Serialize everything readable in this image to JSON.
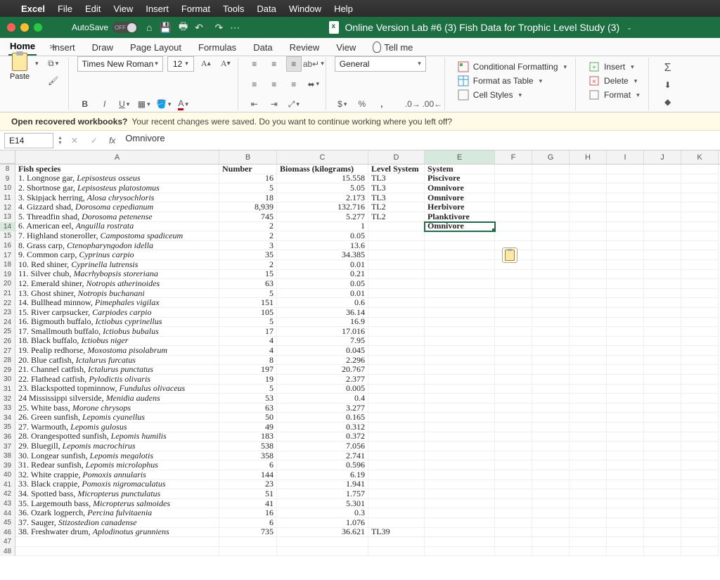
{
  "mac_menu": {
    "app": "Excel",
    "items": [
      "File",
      "Edit",
      "View",
      "Insert",
      "Format",
      "Tools",
      "Data",
      "Window",
      "Help"
    ]
  },
  "titlebar": {
    "autosave_label": "AutoSave",
    "autosave_state": "OFF",
    "doc_title": "Online Version Lab #6 (3) Fish Data for Trophic Level Study (3)"
  },
  "tabs": {
    "items": [
      "Home",
      "Insert",
      "Draw",
      "Page Layout",
      "Formulas",
      "Data",
      "Review",
      "View"
    ],
    "active": "Home",
    "tellme": "Tell me"
  },
  "ribbon": {
    "paste": "Paste",
    "font_name": "Times New Roman",
    "font_size": "12",
    "number_format": "General",
    "cond_fmt": "Conditional Formatting",
    "table": "Format as Table",
    "styles": "Cell Styles",
    "insert": "Insert",
    "delete": "Delete",
    "format": "Format"
  },
  "banner": {
    "bold": "Open recovered workbooks?",
    "rest": "Your recent changes were saved. Do you want to continue working where you left off?"
  },
  "formula_bar": {
    "namebox": "E14",
    "value": "Omnivore"
  },
  "columns": [
    "A",
    "B",
    "C",
    "D",
    "E",
    "F",
    "G",
    "H",
    "I",
    "J",
    "K"
  ],
  "selected_col": "E",
  "active_cell": {
    "row": 14,
    "col": "E"
  },
  "headers_row": 8,
  "headers": {
    "A": "Fish species",
    "B": "Number",
    "C": "Biomass (kilograms)",
    "D": "Level System",
    "E": "System"
  },
  "rows": [
    {
      "r": 9,
      "num": "1.",
      "name": "Longnose gar,",
      "sci": "Lepisosteus osseus",
      "B": "16",
      "C": "15.558",
      "D": "TL3",
      "E": "Piscivore"
    },
    {
      "r": 10,
      "num": "2.",
      "name": "Shortnose gar,",
      "sci": "Lepisosteus platostomus",
      "B": "5",
      "C": "5.05",
      "D": "TL3",
      "E": "Omnivore"
    },
    {
      "r": 11,
      "num": "3.",
      "name": "Skipjack herring,",
      "sci": "Alosa chrysochloris",
      "B": "18",
      "C": "2.173",
      "D": "TL3",
      "E": "Omnivore"
    },
    {
      "r": 12,
      "num": "4.",
      "name": "Gizzard shad,",
      "sci": "Dorosoma cepedianum",
      "B": "8,939",
      "C": "132.716",
      "D": "TL2",
      "E": "Herbivore"
    },
    {
      "r": 13,
      "num": "5.",
      "name": "Threadfin shad,",
      "sci": "Dorosoma petenense",
      "B": "745",
      "C": "5.277",
      "D": "TL2",
      "E": "Planktivore"
    },
    {
      "r": 14,
      "num": "6.",
      "name": "American eel,",
      "sci": "Anguilla rostrata",
      "B": "2",
      "C": "1",
      "D": "",
      "E": "Omnivore"
    },
    {
      "r": 15,
      "num": "7.",
      "name": "Highland stoneroller,",
      "sci": "Campostoma spadiceum",
      "B": "2",
      "C": "0.05",
      "D": "",
      "E": ""
    },
    {
      "r": 16,
      "num": "8.",
      "name": "Grass carp,",
      "sci": "Ctenopharyngodon idella",
      "B": "3",
      "C": "13.6",
      "D": "",
      "E": ""
    },
    {
      "r": 17,
      "num": "9.",
      "name": "Common carp,",
      "sci": "Cyprinus carpio",
      "B": "35",
      "C": "34.385",
      "D": "",
      "E": ""
    },
    {
      "r": 18,
      "num": "10.",
      "name": "Red shiner,",
      "sci": "Cyprinella lutrensis",
      "B": "2",
      "C": "0.01",
      "D": "",
      "E": ""
    },
    {
      "r": 19,
      "num": "11.",
      "name": "Silver chub,",
      "sci": "Macrhybopsis storeriana",
      "B": "15",
      "C": "0.21",
      "D": "",
      "E": ""
    },
    {
      "r": 20,
      "num": "12.",
      "name": "Emerald shiner,",
      "sci": "Notropis atherinoides",
      "B": "63",
      "C": "0.05",
      "D": "",
      "E": ""
    },
    {
      "r": 21,
      "num": "13.",
      "name": "Ghost shiner,",
      "sci": "Notropis buchanani",
      "B": "5",
      "C": "0.01",
      "D": "",
      "E": ""
    },
    {
      "r": 22,
      "num": "14.",
      "name": "Bullhead minnow,",
      "sci": "Pimephales vigilax",
      "B": "151",
      "C": "0.6",
      "D": "",
      "E": ""
    },
    {
      "r": 23,
      "num": "15.",
      "name": "River carpsucker,",
      "sci": "Carpiodes carpio",
      "B": "105",
      "C": "36.14",
      "D": "",
      "E": ""
    },
    {
      "r": 24,
      "num": "16.",
      "name": "Bigmouth buffalo,",
      "sci": "Ictiobus cyprinellus",
      "B": "5",
      "C": "16.9",
      "D": "",
      "E": ""
    },
    {
      "r": 25,
      "num": "17.",
      "name": "Smallmouth buffalo,",
      "sci": "Ictiobus bubalus",
      "B": "17",
      "C": "17.016",
      "D": "",
      "E": ""
    },
    {
      "r": 26,
      "num": "18.",
      "name": "Black buffalo,",
      "sci": "Ictiobus niger",
      "B": "4",
      "C": "7.95",
      "D": "",
      "E": ""
    },
    {
      "r": 27,
      "num": "19.",
      "name": "Pealip redhorse,",
      "sci": "Moxostoma pisolabrum",
      "B": "4",
      "C": "0.045",
      "D": "",
      "E": ""
    },
    {
      "r": 28,
      "num": "20.",
      "name": "Blue catfish,",
      "sci": "Ictalurus furcatus",
      "B": "8",
      "C": "2.296",
      "D": "",
      "E": ""
    },
    {
      "r": 29,
      "num": "21.",
      "name": "Channel catfish,",
      "sci": "Ictalurus punctatus",
      "B": "197",
      "C": "20.767",
      "D": "",
      "E": ""
    },
    {
      "r": 30,
      "num": "22.",
      "name": "Flathead catfish,",
      "sci": "Pylodictis olivaris",
      "B": "19",
      "C": "2.377",
      "D": "",
      "E": ""
    },
    {
      "r": 31,
      "num": "23.",
      "name": "Blackspotted topminnow,",
      "sci": "Fundulus olivaceus",
      "B": "5",
      "C": "0.005",
      "D": "",
      "E": ""
    },
    {
      "r": 32,
      "num": "24",
      "name": "Mississippi silverside,",
      "sci": "Menidia audens",
      "B": "53",
      "C": "0.4",
      "D": "",
      "E": ""
    },
    {
      "r": 33,
      "num": "25.",
      "name": "White bass,",
      "sci": "Morone chrysops",
      "B": "63",
      "C": "3.277",
      "D": "",
      "E": ""
    },
    {
      "r": 34,
      "num": "26.",
      "name": "Green sunfish,",
      "sci": "Lepomis cyanellus",
      "B": "50",
      "C": "0.165",
      "D": "",
      "E": ""
    },
    {
      "r": 35,
      "num": "27.",
      "name": "Warmouth,",
      "sci": "Lepomis gulosus",
      "B": "49",
      "C": "0.312",
      "D": "",
      "E": ""
    },
    {
      "r": 36,
      "num": "28.",
      "name": "Orangespotted sunfish,",
      "sci": "Lepomis humilis",
      "B": "183",
      "C": "0.372",
      "D": "",
      "E": ""
    },
    {
      "r": 37,
      "num": "29.",
      "name": "Bluegill,",
      "sci": "Lepomis macrochirus",
      "B": "538",
      "C": "7.056",
      "D": "",
      "E": ""
    },
    {
      "r": 38,
      "num": "30.",
      "name": "Longear sunfish,",
      "sci": "Lepomis megalotis",
      "B": "358",
      "C": "2.741",
      "D": "",
      "E": ""
    },
    {
      "r": 39,
      "num": "31.",
      "name": "Redear sunfish,",
      "sci": "Lepomis microlophus",
      "B": "6",
      "C": "0.596",
      "D": "",
      "E": ""
    },
    {
      "r": 40,
      "num": "32.",
      "name": "White crappie,",
      "sci": "Pomoxis annularis",
      "B": "144",
      "C": "6.19",
      "D": "",
      "E": ""
    },
    {
      "r": 41,
      "num": "33.",
      "name": "Black crappie,",
      "sci": "Pomoxis nigromaculatus",
      "B": "23",
      "C": "1.941",
      "D": "",
      "E": ""
    },
    {
      "r": 42,
      "num": "34.",
      "name": "Spotted bass,",
      "sci": "Micropterus punctulatus",
      "B": "51",
      "C": "1.757",
      "D": "",
      "E": ""
    },
    {
      "r": 43,
      "num": "35.",
      "name": "Largemouth bass,",
      "sci": "Micropterus salmoides",
      "B": "41",
      "C": "5.301",
      "D": "",
      "E": ""
    },
    {
      "r": 44,
      "num": "36.",
      "name": "Ozark logperch,",
      "sci": "Percina fulvitaenia",
      "B": "16",
      "C": "0.3",
      "D": "",
      "E": ""
    },
    {
      "r": 45,
      "num": "37.",
      "name": "Sauger,",
      "sci": "Stizostedion canadense",
      "B": "6",
      "C": "1.076",
      "D": "",
      "E": ""
    },
    {
      "r": 46,
      "num": "38.",
      "name": "Freshwater drum,",
      "sci": "Aplodinotus grunniens",
      "B": "735",
      "C": "36.621",
      "D": "TL39",
      "E": ""
    }
  ],
  "empty_rows": [
    47,
    48
  ]
}
